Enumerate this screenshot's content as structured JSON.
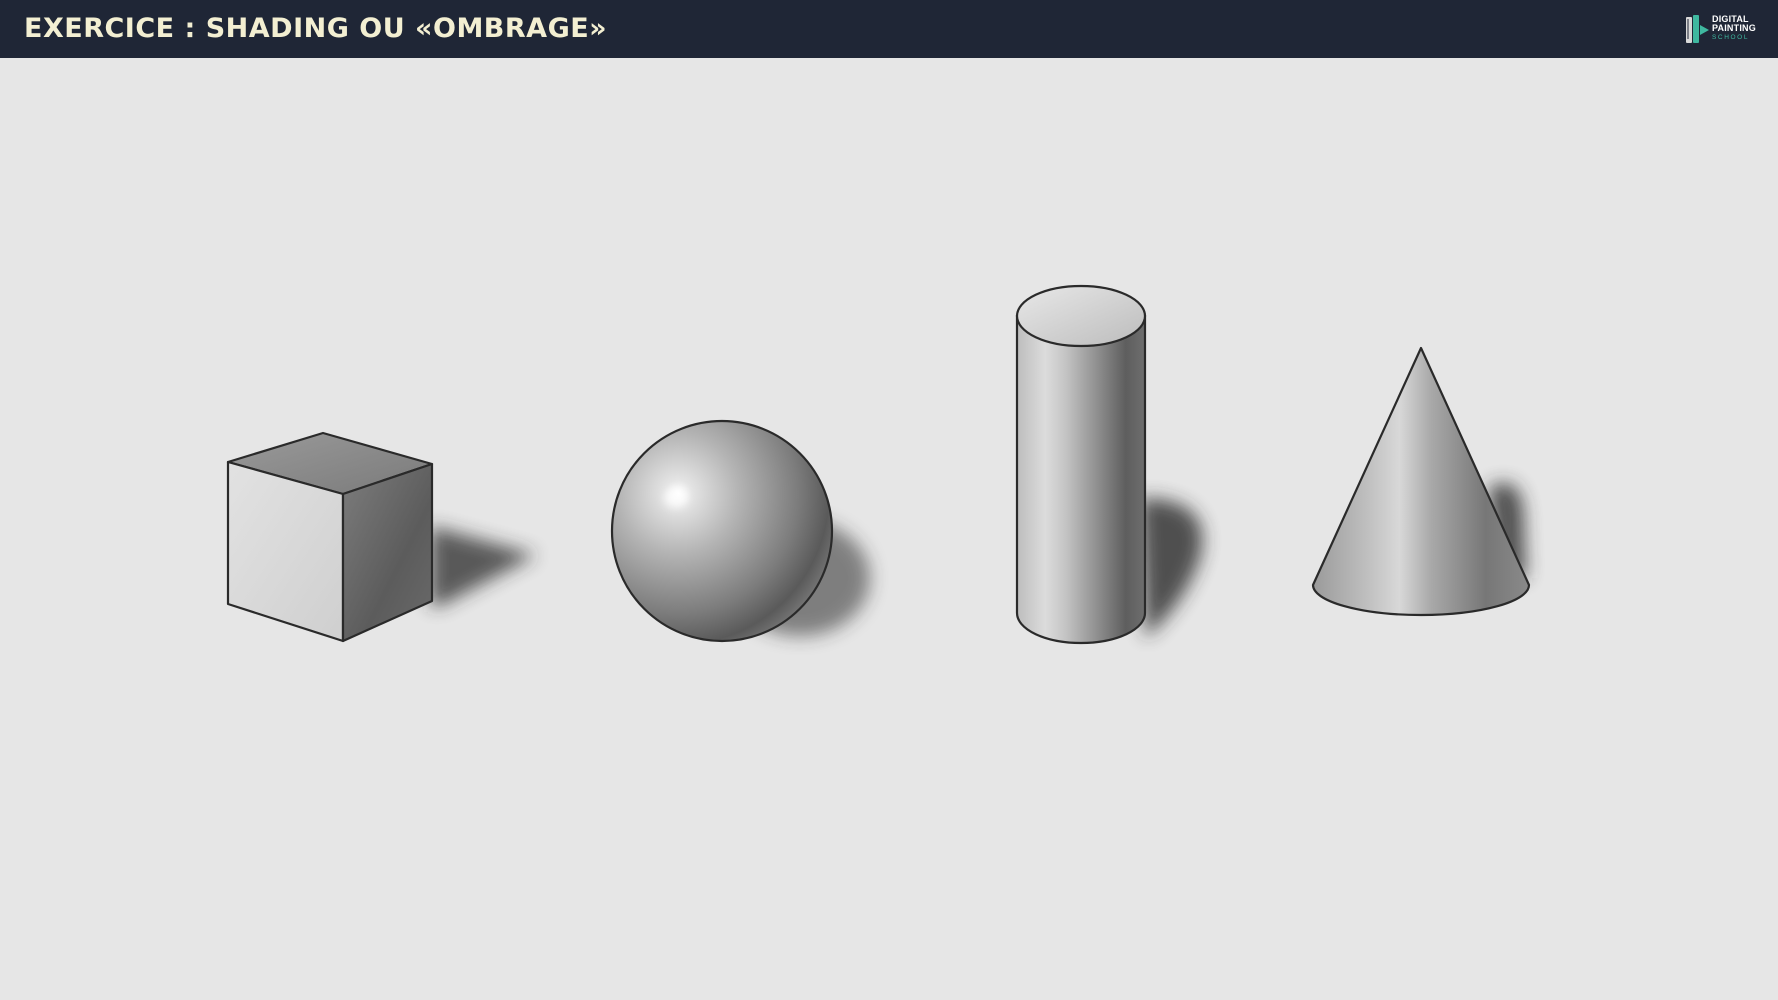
{
  "header": {
    "title": "EXERCICE : SHADING OU «OMBRAGE»",
    "background_color": "#1f2636",
    "title_color": "#f3efd2"
  },
  "logo": {
    "line1": "DIGITAL",
    "line2": "PAINTING",
    "line3": "SCHOOL",
    "accent_color": "#3fb8a0"
  },
  "canvas": {
    "background_color": "#e6e6e6"
  },
  "shapes": [
    {
      "name": "cube"
    },
    {
      "name": "sphere"
    },
    {
      "name": "cylinder"
    },
    {
      "name": "cone"
    }
  ]
}
